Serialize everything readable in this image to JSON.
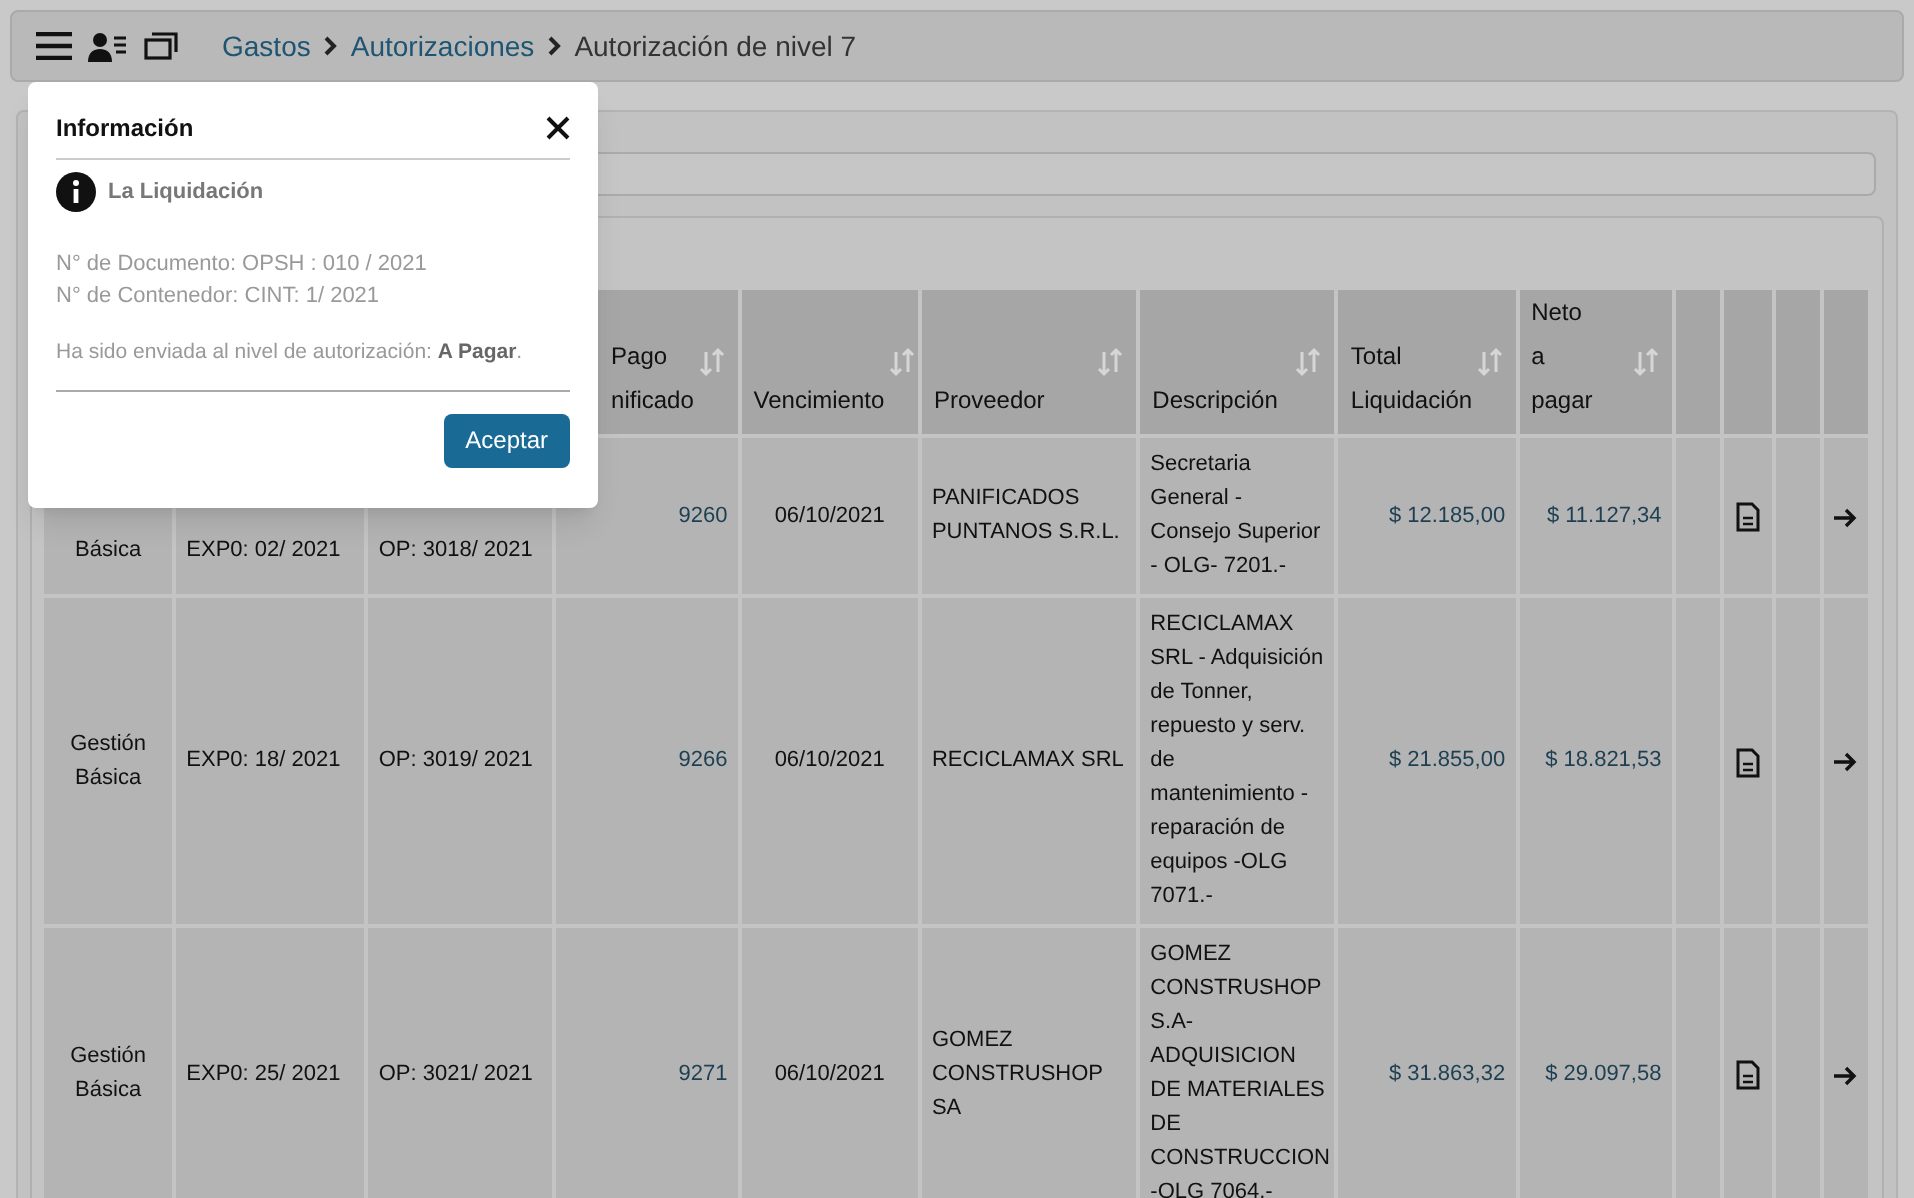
{
  "breadcrumb": [
    "Gastos",
    "Autorizaciones",
    "Autorización de nivel 7"
  ],
  "table": {
    "columns": [
      "",
      "",
      "",
      "Pago\nnificado",
      "Vencimiento",
      "Proveedor",
      "Descripción",
      "Total\nLiquidación",
      "Neto\na\npagar"
    ],
    "rows": [
      {
        "covered": true,
        "cells": [
          "Básica",
          "EXP0: 02/ 2021",
          "OP: 3018/ 2021",
          "9260",
          "06/10/2021",
          "PANIFICADOS PUNTANOS S.R.L.",
          "Secretaria General - Consejo Superior - OLG- 7201.-",
          "$ 12.185,00",
          "$ 11.127,34"
        ]
      },
      {
        "covered": false,
        "cells": [
          "Gestión Básica",
          "EXP0: 18/ 2021",
          "OP: 3019/ 2021",
          "9266",
          "06/10/2021",
          "RECICLAMAX SRL",
          "RECICLAMAX SRL - Adquisición de Tonner, repuesto y serv. de mantenimiento - reparación de equipos -OLG 7071.-",
          "$ 21.855,00",
          "$ 18.821,53"
        ]
      },
      {
        "covered": false,
        "cells": [
          "Gestión Básica",
          "EXP0: 25/ 2021",
          "OP: 3021/ 2021",
          "9271",
          "06/10/2021",
          "GOMEZ CONSTRUSHOP SA",
          "GOMEZ CONSTRUSHOP S.A- ADQUISICION DE MATERIALES DE CONSTRUCCION -OLG 7064.-",
          "$ 31.863,32",
          "$ 29.097,58"
        ]
      }
    ]
  },
  "dialog": {
    "title": "Información",
    "subtitle": "La Liquidación",
    "lines": [
      "N° de Documento: OPSH : 010 / 2021",
      "N° de Contenedor: CINT: 1/ 2021"
    ],
    "message": "Ha sido enviada al nivel de autorización: **A Pagar**.",
    "button": "Aceptar"
  }
}
